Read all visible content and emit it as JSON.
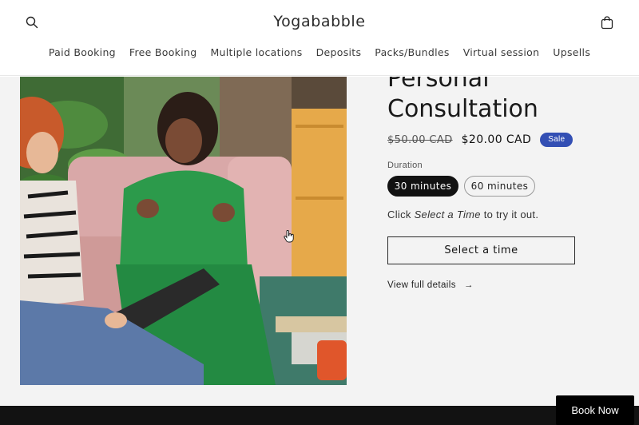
{
  "header": {
    "brand": "Yogababble",
    "search_icon": "search-icon",
    "cart_icon": "bag-icon",
    "nav": [
      {
        "label": "Paid Booking"
      },
      {
        "label": "Free Booking"
      },
      {
        "label": "Multiple locations"
      },
      {
        "label": "Deposits"
      },
      {
        "label": "Packs/Bundles"
      },
      {
        "label": "Virtual session"
      },
      {
        "label": "Upsells"
      }
    ]
  },
  "product": {
    "title_line1": "Personal",
    "title_line2": "Consultation",
    "price_old": "$50.00 CAD",
    "price_new": "$20.00 CAD",
    "badge": "Sale",
    "duration_label": "Duration",
    "durations": [
      {
        "label": "30 minutes",
        "selected": true
      },
      {
        "label": "60 minutes",
        "selected": false
      }
    ],
    "cta_prefix": "Click ",
    "cta_emphasis": "Select a Time",
    "cta_suffix": " to try it out.",
    "select_button": "Select a time",
    "details_link": "View full details",
    "details_arrow": "→"
  },
  "floating": {
    "book_now": "Book Now"
  },
  "colors": {
    "accent_badge": "#334fb4",
    "primary": "#121212",
    "background": "#f3f3f3"
  }
}
